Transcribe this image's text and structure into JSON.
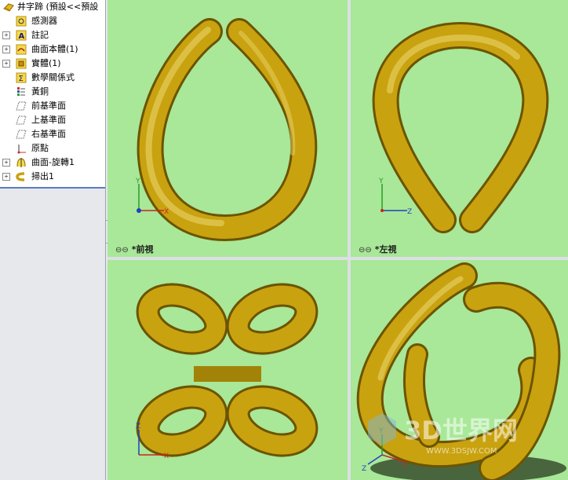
{
  "tree": {
    "root_label": "井字蹄 (預設<<預設",
    "items": [
      {
        "label": "感測器",
        "expandable": false,
        "icon": "sensor-icon"
      },
      {
        "label": "註記",
        "expandable": true,
        "icon": "annotation-icon"
      },
      {
        "label": "曲面本體(1)",
        "expandable": true,
        "icon": "surface-bodies-icon"
      },
      {
        "label": "實體(1)",
        "expandable": true,
        "icon": "solid-bodies-icon"
      },
      {
        "label": "數學關係式",
        "expandable": false,
        "icon": "equations-icon"
      },
      {
        "label": "黃銅",
        "expandable": false,
        "icon": "material-icon"
      },
      {
        "label": "前基準面",
        "expandable": false,
        "icon": "plane-icon"
      },
      {
        "label": "上基準面",
        "expandable": false,
        "icon": "plane-icon"
      },
      {
        "label": "右基準面",
        "expandable": false,
        "icon": "plane-icon"
      },
      {
        "label": "原點",
        "expandable": false,
        "icon": "origin-icon"
      },
      {
        "label": "曲面-旋轉1",
        "expandable": true,
        "icon": "revolve-surface-icon"
      },
      {
        "label": "掃出1",
        "expandable": true,
        "icon": "sweep-icon"
      }
    ]
  },
  "viewports": {
    "front": {
      "label": "*前視",
      "axes": [
        "Y",
        "X"
      ]
    },
    "left": {
      "label": "*左視",
      "axes": [
        "Y",
        "Z"
      ]
    },
    "top": {
      "label": "",
      "axes": [
        "Z",
        "X"
      ]
    },
    "iso": {
      "label": "",
      "axes": [
        "Y",
        "Z",
        "X"
      ]
    }
  },
  "watermark": {
    "text": "3D世界网",
    "url": "WWW.3DSJW.COM"
  },
  "colors": {
    "background": "#a8e898",
    "model": "#c9a20f",
    "model_dark": "#6b5400",
    "model_light": "#f1dd6a"
  }
}
